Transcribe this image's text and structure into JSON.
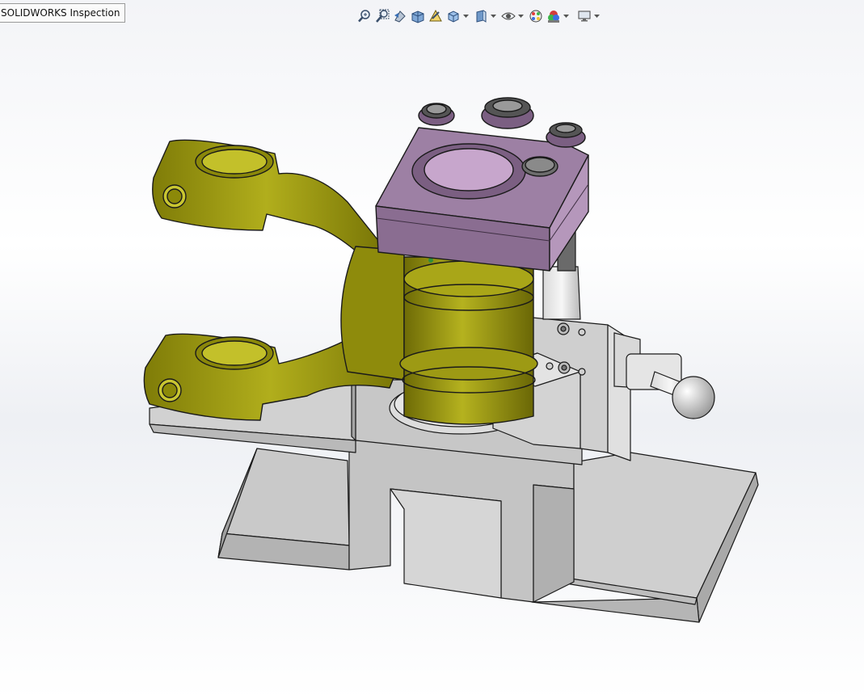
{
  "window": {
    "tab_title": "SOLIDWORKS Inspection"
  },
  "toolbar": {
    "items": [
      "zoom-to-fit-icon",
      "zoom-to-area-icon",
      "previous-view-icon",
      "section-view-icon",
      "dynamic-annotation-icon",
      "view-orientation-icon",
      "display-style-icon",
      "hide-show-items-icon",
      "edit-appearance-icon",
      "apply-scene-icon",
      "view-settings-icon"
    ]
  },
  "colors": {
    "yoke": "#9d9a10",
    "yoke_dark": "#6f6c08",
    "clamp_plate": "#8d6f93",
    "clamp_plate_top": "#9c7ea3",
    "fixture_base": "#c9c9c9",
    "fixture_base_dark": "#a8a8a8",
    "background": "#ffffff"
  }
}
